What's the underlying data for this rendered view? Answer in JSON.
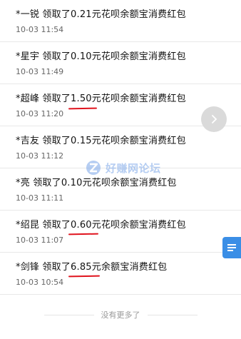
{
  "records": [
    {
      "title": "*一锐 领取了0.21元花呗余额宝消费红包",
      "time": "10-03 11:54"
    },
    {
      "title": "*星宇 领取了0.10元花呗余额宝消费红包",
      "time": "10-03 11:49"
    },
    {
      "title": "*超峰 领取了1.50元花呗余额宝消费红包",
      "time": "10-03 11:20"
    },
    {
      "title": "*吉友 领取了0.15元花呗余额宝消费红包",
      "time": "10-03 11:12"
    },
    {
      "title": "*亮 领取了0.10元花呗余额宝消费红包",
      "time": "10-03 11:11"
    },
    {
      "title": "*绍昆 领取了0.60元花呗余额宝消费红包",
      "time": "10-03 11:07"
    },
    {
      "title": "*剑锋 领取了6.85元余额宝消费红包",
      "time": "10-03 10:54"
    }
  ],
  "footer": {
    "no_more": "没有更多了"
  },
  "watermark": {
    "text": "好赚网论坛"
  },
  "colors": {
    "underline": "#e0141e",
    "float_button": "#3a8ee6",
    "scroll_button": "#dadada"
  },
  "icons": {
    "scroll": "chevron-right-icon",
    "float": "list-icon",
    "watermark": "z-logo-icon"
  }
}
